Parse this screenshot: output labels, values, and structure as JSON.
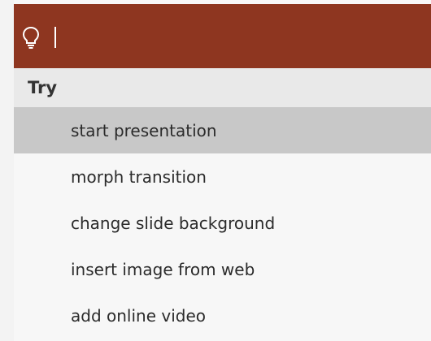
{
  "search": {
    "value": "",
    "icon": "lightbulb-icon",
    "bar_color": "#8e3620"
  },
  "try_section": {
    "header": "Try",
    "items": [
      {
        "label": "start presentation",
        "selected": true
      },
      {
        "label": "morph transition",
        "selected": false
      },
      {
        "label": "change slide background",
        "selected": false
      },
      {
        "label": "insert image from web",
        "selected": false
      },
      {
        "label": "add online video",
        "selected": false
      }
    ]
  }
}
